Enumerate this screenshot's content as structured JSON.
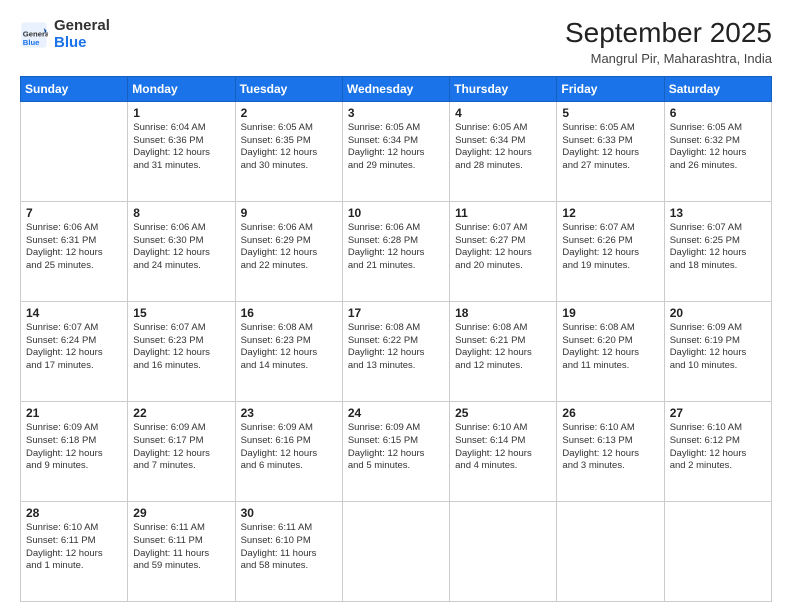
{
  "logo": {
    "general": "General",
    "blue": "Blue"
  },
  "header": {
    "month": "September 2025",
    "location": "Mangrul Pir, Maharashtra, India"
  },
  "weekdays": [
    "Sunday",
    "Monday",
    "Tuesday",
    "Wednesday",
    "Thursday",
    "Friday",
    "Saturday"
  ],
  "weeks": [
    [
      {
        "day": "",
        "info": ""
      },
      {
        "day": "1",
        "info": "Sunrise: 6:04 AM\nSunset: 6:36 PM\nDaylight: 12 hours\nand 31 minutes."
      },
      {
        "day": "2",
        "info": "Sunrise: 6:05 AM\nSunset: 6:35 PM\nDaylight: 12 hours\nand 30 minutes."
      },
      {
        "day": "3",
        "info": "Sunrise: 6:05 AM\nSunset: 6:34 PM\nDaylight: 12 hours\nand 29 minutes."
      },
      {
        "day": "4",
        "info": "Sunrise: 6:05 AM\nSunset: 6:34 PM\nDaylight: 12 hours\nand 28 minutes."
      },
      {
        "day": "5",
        "info": "Sunrise: 6:05 AM\nSunset: 6:33 PM\nDaylight: 12 hours\nand 27 minutes."
      },
      {
        "day": "6",
        "info": "Sunrise: 6:05 AM\nSunset: 6:32 PM\nDaylight: 12 hours\nand 26 minutes."
      }
    ],
    [
      {
        "day": "7",
        "info": "Sunrise: 6:06 AM\nSunset: 6:31 PM\nDaylight: 12 hours\nand 25 minutes."
      },
      {
        "day": "8",
        "info": "Sunrise: 6:06 AM\nSunset: 6:30 PM\nDaylight: 12 hours\nand 24 minutes."
      },
      {
        "day": "9",
        "info": "Sunrise: 6:06 AM\nSunset: 6:29 PM\nDaylight: 12 hours\nand 22 minutes."
      },
      {
        "day": "10",
        "info": "Sunrise: 6:06 AM\nSunset: 6:28 PM\nDaylight: 12 hours\nand 21 minutes."
      },
      {
        "day": "11",
        "info": "Sunrise: 6:07 AM\nSunset: 6:27 PM\nDaylight: 12 hours\nand 20 minutes."
      },
      {
        "day": "12",
        "info": "Sunrise: 6:07 AM\nSunset: 6:26 PM\nDaylight: 12 hours\nand 19 minutes."
      },
      {
        "day": "13",
        "info": "Sunrise: 6:07 AM\nSunset: 6:25 PM\nDaylight: 12 hours\nand 18 minutes."
      }
    ],
    [
      {
        "day": "14",
        "info": "Sunrise: 6:07 AM\nSunset: 6:24 PM\nDaylight: 12 hours\nand 17 minutes."
      },
      {
        "day": "15",
        "info": "Sunrise: 6:07 AM\nSunset: 6:23 PM\nDaylight: 12 hours\nand 16 minutes."
      },
      {
        "day": "16",
        "info": "Sunrise: 6:08 AM\nSunset: 6:23 PM\nDaylight: 12 hours\nand 14 minutes."
      },
      {
        "day": "17",
        "info": "Sunrise: 6:08 AM\nSunset: 6:22 PM\nDaylight: 12 hours\nand 13 minutes."
      },
      {
        "day": "18",
        "info": "Sunrise: 6:08 AM\nSunset: 6:21 PM\nDaylight: 12 hours\nand 12 minutes."
      },
      {
        "day": "19",
        "info": "Sunrise: 6:08 AM\nSunset: 6:20 PM\nDaylight: 12 hours\nand 11 minutes."
      },
      {
        "day": "20",
        "info": "Sunrise: 6:09 AM\nSunset: 6:19 PM\nDaylight: 12 hours\nand 10 minutes."
      }
    ],
    [
      {
        "day": "21",
        "info": "Sunrise: 6:09 AM\nSunset: 6:18 PM\nDaylight: 12 hours\nand 9 minutes."
      },
      {
        "day": "22",
        "info": "Sunrise: 6:09 AM\nSunset: 6:17 PM\nDaylight: 12 hours\nand 7 minutes."
      },
      {
        "day": "23",
        "info": "Sunrise: 6:09 AM\nSunset: 6:16 PM\nDaylight: 12 hours\nand 6 minutes."
      },
      {
        "day": "24",
        "info": "Sunrise: 6:09 AM\nSunset: 6:15 PM\nDaylight: 12 hours\nand 5 minutes."
      },
      {
        "day": "25",
        "info": "Sunrise: 6:10 AM\nSunset: 6:14 PM\nDaylight: 12 hours\nand 4 minutes."
      },
      {
        "day": "26",
        "info": "Sunrise: 6:10 AM\nSunset: 6:13 PM\nDaylight: 12 hours\nand 3 minutes."
      },
      {
        "day": "27",
        "info": "Sunrise: 6:10 AM\nSunset: 6:12 PM\nDaylight: 12 hours\nand 2 minutes."
      }
    ],
    [
      {
        "day": "28",
        "info": "Sunrise: 6:10 AM\nSunset: 6:11 PM\nDaylight: 12 hours\nand 1 minute."
      },
      {
        "day": "29",
        "info": "Sunrise: 6:11 AM\nSunset: 6:11 PM\nDaylight: 11 hours\nand 59 minutes."
      },
      {
        "day": "30",
        "info": "Sunrise: 6:11 AM\nSunset: 6:10 PM\nDaylight: 11 hours\nand 58 minutes."
      },
      {
        "day": "",
        "info": ""
      },
      {
        "day": "",
        "info": ""
      },
      {
        "day": "",
        "info": ""
      },
      {
        "day": "",
        "info": ""
      }
    ]
  ]
}
